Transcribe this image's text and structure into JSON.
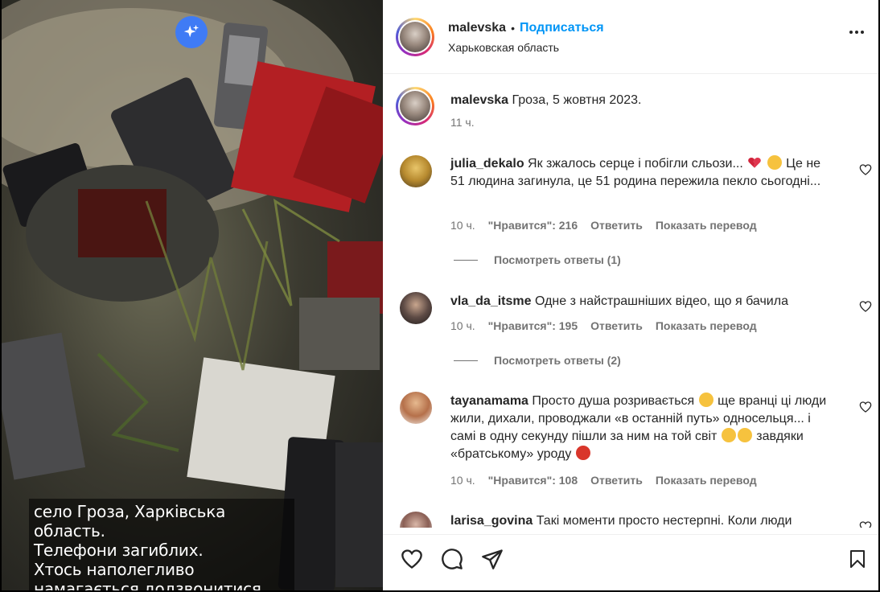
{
  "media": {
    "caption_lines": [
      "село Гроза, Харківська область.",
      "Телефони загиблих.",
      "Хтось наполегливо",
      "намагається додзвонитися."
    ],
    "ai_badge_icon": "sparkles-icon"
  },
  "header": {
    "username": "malevska",
    "separator": "•",
    "follow_label": "Подписаться",
    "location": "Харьковская область"
  },
  "post": {
    "username": "malevska",
    "text": "Гроза, 5 жовтня 2023.",
    "time": "11 ч."
  },
  "comments": [
    {
      "username": "julia_dekalo",
      "text_before": "Як зжалось серце і побігли сльози...",
      "text_after": "Це не 51 людина загинула, це 51 родина пережила пекло сьогодні...",
      "time": "10 ч.",
      "likes": "\"Нравится\": 216",
      "reply_label": "Ответить",
      "translate_label": "Показать перевод",
      "view_replies": "Посмотреть ответы (1)"
    },
    {
      "username": "vla_da_itsme",
      "text": "Одне з найстрашніших відео, що я бачила",
      "time": "10 ч.",
      "likes": "\"Нравится\": 195",
      "reply_label": "Ответить",
      "translate_label": "Показать перевод",
      "view_replies": "Посмотреть ответы (2)"
    },
    {
      "username": "tayanamama",
      "text_part1": "Просто душа розривається",
      "text_part2": "ще вранці ці люди жили, дихали, проводжали «в останній путь» односельця... і самі в одну секунду пішли за ним на той світ",
      "text_part3": "завдяки «братському» уроду",
      "time": "10 ч.",
      "likes": "\"Нравится\": 108",
      "reply_label": "Ответить",
      "translate_label": "Показать перевод"
    },
    {
      "username": "larisa_govina",
      "text": "Такі моменти просто нестерпні. Коли люди"
    }
  ],
  "icons": {
    "like": "heart-icon",
    "comment": "comment-icon",
    "share": "share-icon",
    "save": "bookmark-icon",
    "more": "more-icon"
  },
  "colors": {
    "link_blue": "#0095f6",
    "muted": "#737373",
    "text": "#262626"
  }
}
